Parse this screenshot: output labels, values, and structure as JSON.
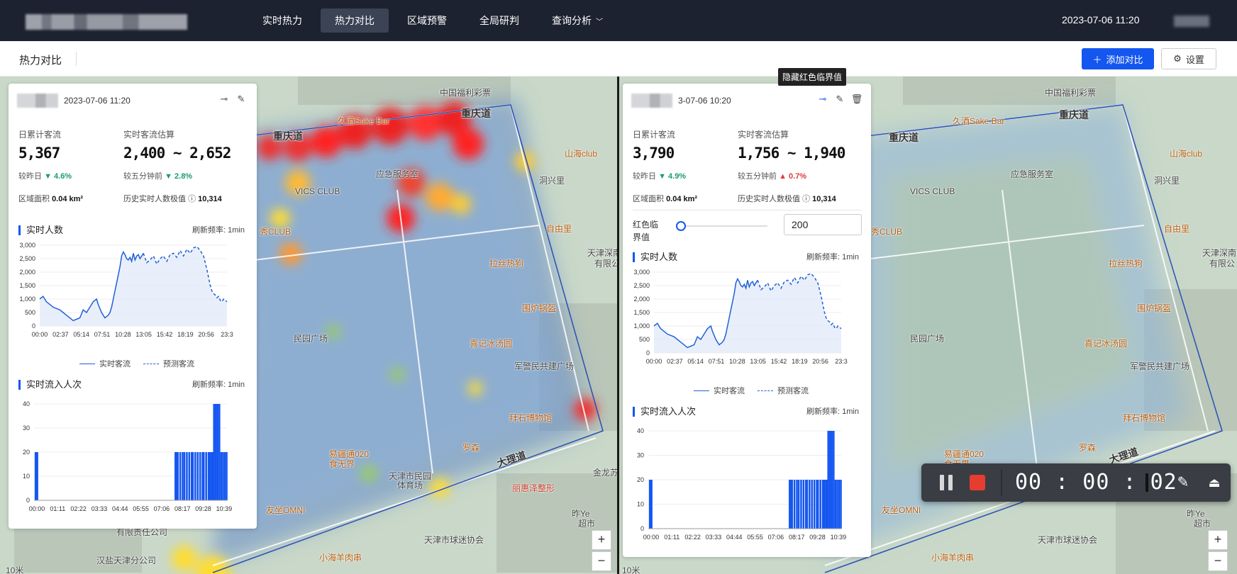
{
  "nav": {
    "items": [
      "实时热力",
      "热力对比",
      "区域预警",
      "全局研判",
      "查询分析"
    ],
    "active_index": 1,
    "datetime": "2023-07-06 11:20"
  },
  "subbar": {
    "title": "热力对比",
    "add_compare": "添加对比",
    "settings": "设置"
  },
  "tooltip": "隐藏红色临界值",
  "map": {
    "pois": [
      "中国福利彩票",
      "久酒Sake Bar",
      "重庆道",
      "山海club",
      "应急服务室",
      "洞兴里",
      "VICS CLUB",
      "秀CLUB",
      "自由里",
      "拉丝热狗",
      "天津深南",
      "有限公",
      "围炉锅盔",
      "民园广场",
      "喜记冰汤圆",
      "军警民共建广场",
      "拜石博物馆",
      "罗森",
      "易疆通020",
      "食无界",
      "天津市民园",
      "体育场",
      "大理道",
      "金龙苏",
      "丽惠泽整形",
      "友坐OMNI",
      "天津市球迷协会",
      "小海羊肉串",
      "汉盐天津分公司",
      "有限责任公司",
      "昨Ye",
      "超市"
    ],
    "zoom_in": "+",
    "zoom_out": "−",
    "scale_left": "10米",
    "scale_right": "10米"
  },
  "panel_left": {
    "date": "2023-07-06 11:20",
    "daily_label": "日累计客流",
    "daily_value": "5,367",
    "rt_label": "实时客流估算",
    "rt_value": "2,400 ~ 2,652",
    "cmp_day_label": "较昨日",
    "cmp_day_value": "4.6%",
    "cmp_day_dir": "down",
    "cmp_5m_label": "较五分钟前",
    "cmp_5m_value": "2.8%",
    "cmp_5m_dir": "down",
    "area_label": "区域面积",
    "area_value": "0.04 km²",
    "hist_label": "历史实时人数极值",
    "hist_value": "10,314"
  },
  "panel_right": {
    "date": "3-07-06 10:20",
    "daily_label": "日累计客流",
    "daily_value": "3,790",
    "rt_label": "实时客流估算",
    "rt_value": "1,756 ~ 1,940",
    "cmp_day_label": "较昨日",
    "cmp_day_value": "4.9%",
    "cmp_day_dir": "down",
    "cmp_5m_label": "较五分钟前",
    "cmp_5m_value": "0.7%",
    "cmp_5m_dir": "up",
    "area_label": "区域面积",
    "area_value": "0.04 km²",
    "hist_label": "历史实时人数极值",
    "hist_value": "10,314",
    "threshold_label": "红色临界值",
    "threshold_value": "200",
    "threshold_slider": 0.0
  },
  "sections": {
    "realtime_title": "实时人数",
    "inflow_title": "实时流入人次",
    "refresh": "刷新频率: 1min",
    "legend_actual": "实时客流",
    "legend_pred": "预测客流"
  },
  "colors": {
    "accent": "#1456f0",
    "down": "#1a9e6a",
    "up": "#e03a3a",
    "line": "#2060d8",
    "navbg": "#1c2230"
  },
  "recorder": {
    "time": "00 : 00 : 02"
  },
  "chart_data": [
    {
      "type": "line",
      "title": "实时人数",
      "categories": [
        "00:00",
        "02:37",
        "05:14",
        "07:51",
        "10:28",
        "13:05",
        "15:42",
        "18:19",
        "20:56",
        "23:3"
      ],
      "ylim": [
        0,
        3000
      ],
      "yticks": [
        "0",
        "500",
        "1,000",
        "1,500",
        "2,000",
        "2,500",
        "3,000"
      ],
      "series": [
        {
          "name": "实时客流",
          "x": [
            0,
            20,
            40,
            60,
            80,
            100,
            120,
            140,
            160,
            180,
            200,
            220,
            240,
            260,
            280,
            300,
            320,
            340,
            350,
            360,
            370,
            380,
            390,
            400,
            410,
            420,
            430,
            440,
            450,
            460,
            470,
            480,
            490,
            500,
            510,
            520,
            530,
            540,
            550,
            560,
            570,
            580,
            590,
            600,
            610,
            620
          ],
          "values": [
            1000,
            1100,
            900,
            800,
            700,
            650,
            600,
            500,
            400,
            300,
            200,
            250,
            300,
            600,
            500,
            700,
            900,
            1000,
            800,
            650,
            500,
            400,
            300,
            350,
            400,
            500,
            700,
            1000,
            1300,
            1600,
            1900,
            2200,
            2600,
            2750,
            2650,
            2500,
            2450,
            2550,
            2400,
            2700,
            2450,
            2600,
            2650,
            2500,
            2600,
            2700
          ]
        },
        {
          "name": "预测客流",
          "x": [
            620,
            640,
            660,
            680,
            700,
            720,
            740,
            760,
            780,
            800,
            820,
            840,
            860,
            880,
            900,
            920,
            940,
            960,
            980,
            1000,
            1010,
            1020,
            1030,
            1040,
            1050,
            1060,
            1070,
            1080,
            1090,
            1100,
            1110,
            1120
          ],
          "values": [
            2700,
            2350,
            2450,
            2600,
            2300,
            2500,
            2600,
            2400,
            2650,
            2700,
            2550,
            2800,
            2600,
            2850,
            2700,
            2900,
            2950,
            2800,
            2600,
            2100,
            1800,
            1500,
            1300,
            1200,
            1150,
            1050,
            1100,
            950,
            900,
            1000,
            950,
            900
          ]
        }
      ]
    },
    {
      "type": "bar",
      "title": "实时流入人次",
      "categories": [
        "00:00",
        "01:11",
        "02:22",
        "03:33",
        "04:44",
        "05:55",
        "07:06",
        "08:17",
        "09:28",
        "10:39"
      ],
      "ylim": [
        0,
        40
      ],
      "yticks": [
        "0",
        "10",
        "20",
        "30",
        "40"
      ],
      "series": [
        {
          "name": "实时流入人次",
          "x": [
            2,
            4,
            6,
            8,
            466,
            470,
            474,
            482,
            490,
            496,
            504,
            512,
            520,
            524,
            532,
            540,
            548,
            556,
            560,
            568,
            576,
            580,
            586,
            590,
            594,
            600,
            606,
            612,
            618,
            624,
            630,
            636
          ],
          "values": [
            20,
            20,
            20,
            20,
            20,
            20,
            20,
            20,
            20,
            20,
            20,
            20,
            20,
            20,
            20,
            20,
            20,
            20,
            20,
            20,
            20,
            20,
            20,
            20,
            40,
            40,
            40,
            40,
            20,
            20,
            20,
            20
          ]
        }
      ]
    }
  ]
}
